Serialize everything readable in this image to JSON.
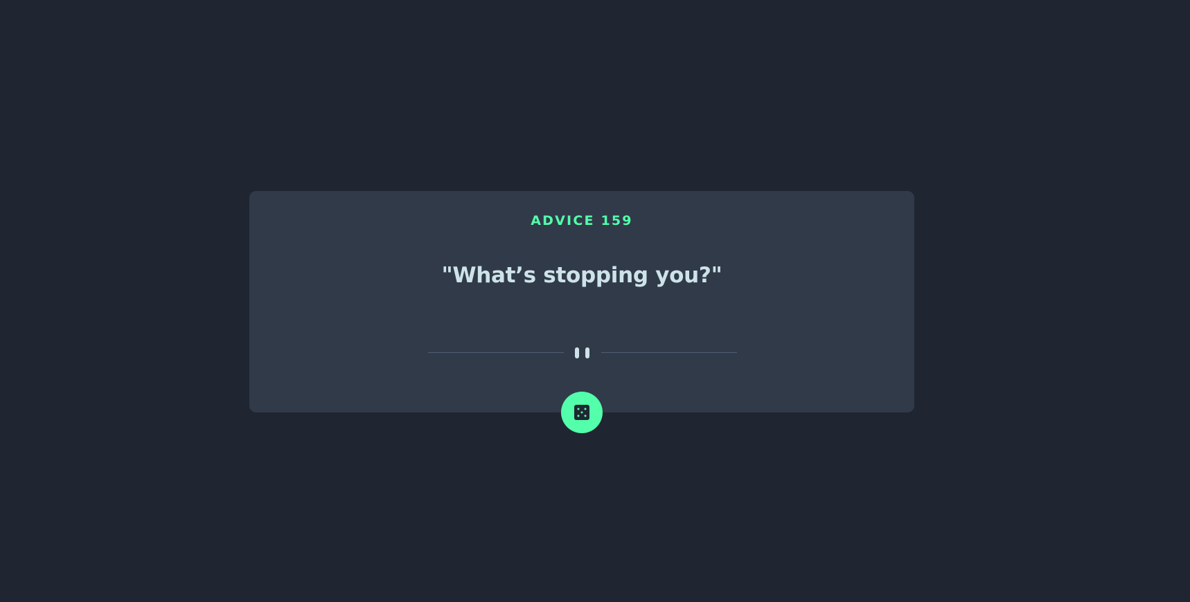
{
  "advice": {
    "label": "ADVICE 159",
    "quote": "\"What’s stopping you?\""
  },
  "divider": {
    "icon": "pause-icon"
  },
  "dice_button": {
    "icon": "dice-icon"
  },
  "colors": {
    "background": "#1f2632",
    "card": "#313a49",
    "accent": "#53ffaa",
    "text": "#cee3e9",
    "divider": "#4f5d74"
  }
}
